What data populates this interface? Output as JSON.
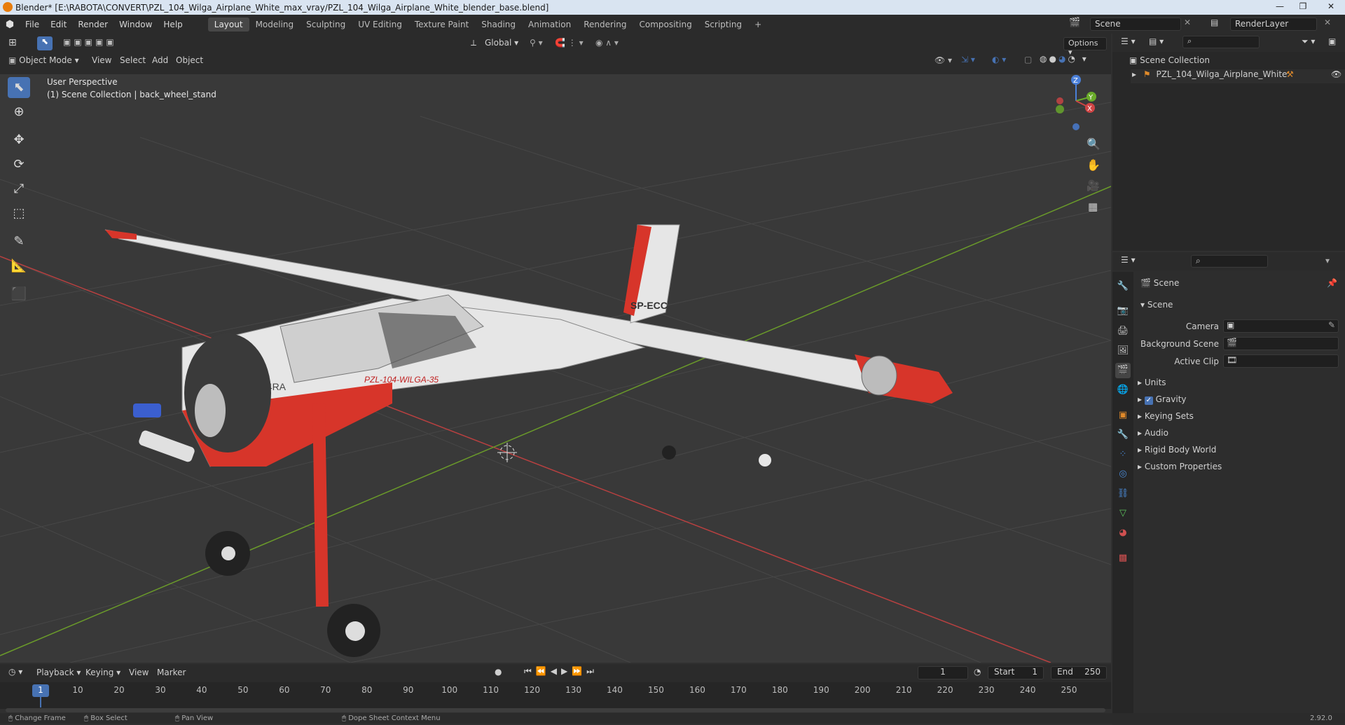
{
  "window": {
    "title": "Blender* [E:\\RABOTA\\CONVERT\\PZL_104_Wilga_Airplane_White_max_vray/PZL_104_Wilga_Airplane_White_blender_base.blend]"
  },
  "menu": {
    "items": [
      "File",
      "Edit",
      "Render",
      "Window",
      "Help"
    ]
  },
  "workspaces": [
    "Layout",
    "Modeling",
    "Sculpting",
    "UV Editing",
    "Texture Paint",
    "Shading",
    "Animation",
    "Rendering",
    "Compositing",
    "Scripting"
  ],
  "workspace_add": "+",
  "scene_field": "Scene",
  "renderlayer_field": "RenderLayer",
  "viewport_header": {
    "transform_orientation": "Global",
    "options": "Options",
    "mode": "Object Mode",
    "menus": [
      "View",
      "Select",
      "Add",
      "Object"
    ]
  },
  "viewport": {
    "perspective": "User Perspective",
    "collection_info": "(1) Scene Collection | back_wheel_stand",
    "axis_labels": {
      "x": "X",
      "y": "Y",
      "z": "Z"
    }
  },
  "outliner": {
    "root": "Scene Collection",
    "items": [
      {
        "label": "PZL_104_Wilga_Airplane_White"
      }
    ]
  },
  "properties": {
    "breadcrumb": "Scene",
    "panel_title": "Scene",
    "fields": [
      {
        "label": "Camera",
        "value": ""
      },
      {
        "label": "Background Scene",
        "value": ""
      },
      {
        "label": "Active Clip",
        "value": ""
      }
    ],
    "sections": [
      {
        "label": "Units"
      },
      {
        "label": "Gravity",
        "checked": true
      },
      {
        "label": "Keying Sets"
      },
      {
        "label": "Audio"
      },
      {
        "label": "Rigid Body World"
      },
      {
        "label": "Custom Properties"
      }
    ]
  },
  "timeline": {
    "menus": [
      "Playback",
      "Keying",
      "View",
      "Marker"
    ],
    "current_frame": "1",
    "start_label": "Start",
    "start": "1",
    "end_label": "End",
    "end": "250",
    "ticks": [
      "1",
      "10",
      "20",
      "30",
      "40",
      "50",
      "60",
      "70",
      "80",
      "90",
      "100",
      "110",
      "120",
      "130",
      "140",
      "150",
      "160",
      "170",
      "180",
      "190",
      "200",
      "210",
      "220",
      "230",
      "240",
      "250"
    ]
  },
  "statusbar": {
    "items": [
      "Change Frame",
      "Box Select",
      "Pan View",
      "Dope Sheet Context Menu"
    ],
    "version": "2.92.0"
  },
  "aircraft_markings": {
    "fuselage_reg": "AJ-14RA",
    "door_text": "PZL-104-WILGA-35",
    "tail_text": "SP-ECC"
  },
  "colors": {
    "accent": "#4772b3",
    "header": "#2b2b2b",
    "viewport": "#3a3a3a",
    "aircraft_red": "#d7352a",
    "aircraft_white": "#e6e6e6"
  }
}
